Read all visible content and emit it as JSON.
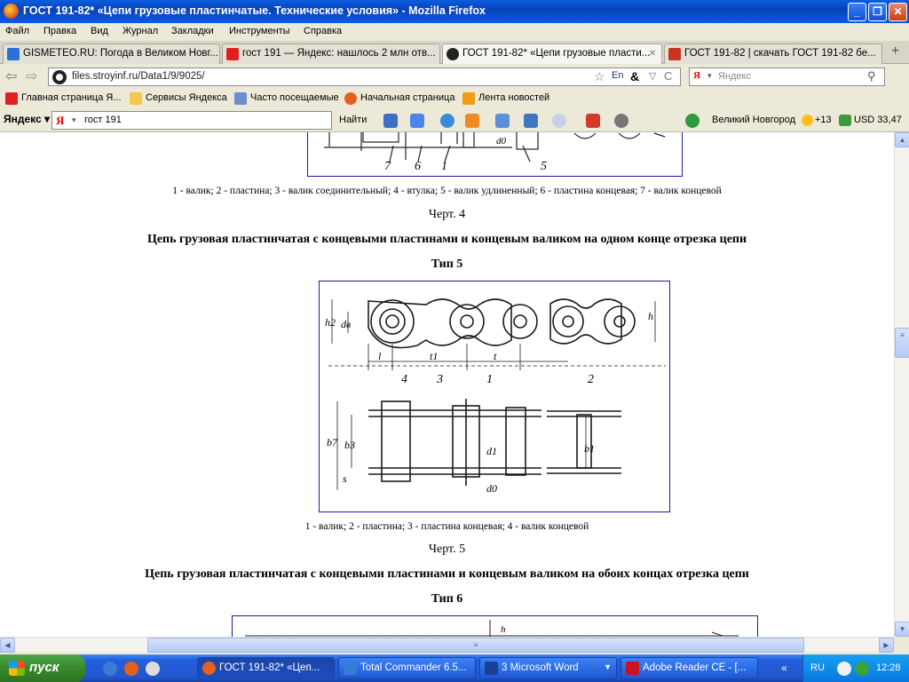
{
  "window": {
    "title": "ГОСТ 191-82* «Цепи грузовые пластинчатые. Технические условия» - Mozilla Firefox"
  },
  "menu": [
    "Файл",
    "Правка",
    "Вид",
    "Журнал",
    "Закладки",
    "Инструменты",
    "Справка"
  ],
  "tabs": [
    {
      "label": "GISMETEO.RU: Погода в Великом Новг...",
      "color": "#2a6fd4"
    },
    {
      "label": "гост 191 — Яндекс: нашлось 2 млн отв...",
      "color": "#e02020"
    },
    {
      "label": "ГОСТ 191-82* «Цепи грузовые пласти...",
      "color": "#222222"
    },
    {
      "label": "ГОСТ 191-82 | скачать ГОСТ 191-82 бе...",
      "color": "#c8321e"
    }
  ],
  "new_tab": "+",
  "address": {
    "url": "files.stroyinf.ru/Data1/9/9025/",
    "search_placeholder": "Яндекс"
  },
  "bookmarks": [
    "Главная страница Я...",
    "Сервисы Яндекса",
    "Часто посещаемые",
    "Начальная страница",
    "Лента новостей"
  ],
  "yandex_bar": {
    "logo": "Яндекс",
    "query": "гост 191",
    "find": "Найти",
    "city": "Великий Новгород",
    "temp": "+13",
    "currency": "USD 33,47"
  },
  "page": {
    "fig4_labels": [
      "7",
      "6",
      "1",
      "5",
      "d0"
    ],
    "caption4": "1 - валик; 2 - пластина; 3 - валик соединительный; 4 - втулка; 5 - валик удлиненный; 6 - пластина концевая; 7 - валик концевой",
    "chert4": "Черт. 4",
    "heading5": "Цепь грузовая пластинчатая с концевыми пластинами и концевым валиком на одном конце отрезка цепи",
    "type5": "Тип 5",
    "fig5_labels": [
      "h2",
      "dв",
      "h",
      "l",
      "t1",
      "t",
      "4",
      "3",
      "1",
      "2",
      "b7",
      "b3",
      "s",
      "b1",
      "d1",
      "d0"
    ],
    "caption5": "1 - валик; 2 - пластина; 3 - пластина концевая; 4 - валик концевой",
    "chert5": "Черт. 5",
    "heading6": "Цепь грузовая пластинчатая с концевыми пластинами и концевым валиком на обоих концах отрезка цепи",
    "type6": "Тип 6",
    "fig6_labels": [
      "h"
    ]
  },
  "taskbar": {
    "start": "пуск",
    "tasks": [
      {
        "label": "ГОСТ 191-82* «Цеп...",
        "color": "#e5611b"
      },
      {
        "label": "Total Commander 6.5...",
        "color": "#3a7bd5"
      },
      {
        "label": "3 Microsoft Word",
        "color": "#1c3f95"
      },
      {
        "label": "Adobe Reader CE - [...",
        "color": "#c8141e"
      }
    ],
    "lang": "RU",
    "clock": "12:28"
  }
}
